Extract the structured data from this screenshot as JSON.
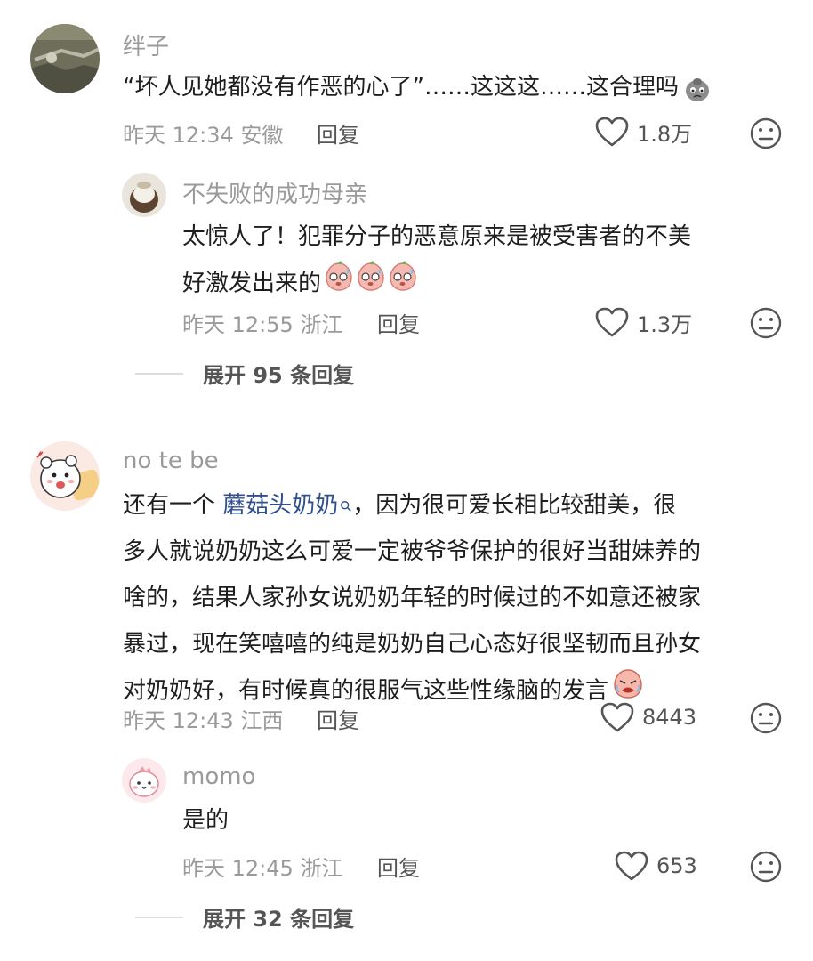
{
  "comments": [
    {
      "username": "绊子",
      "text": "“坏人见她都没有作恶的心了”……这这这……这合理吗",
      "time": "昨天 12:34",
      "location": "安徽",
      "reply_label": "回复",
      "likes": "1.8万",
      "replies": [
        {
          "username": "不失败的成功母亲",
          "text_line1": "太惊人了！犯罪分子的恶意原来是被受害者的不美",
          "text_line2": "好激发出来的",
          "time": "昨天 12:55",
          "location": "浙江",
          "reply_label": "回复",
          "likes": "1.3万"
        }
      ],
      "expand_label": "展开 95 条回复"
    },
    {
      "username": "no te be",
      "text_prefix": "还有一个",
      "mention": "蘑菇头奶奶",
      "text_line1_rest": "，因为很可爱长相比较甜美，很",
      "text_line2": "多人就说奶奶这么可爱一定被爷爷保护的很好当甜妹养的",
      "text_line3": "啥的，结果人家孙女说奶奶年轻的时候过的不如意还被家",
      "text_line4": "暴过，现在笑嘻嘻的纯是奶奶自己心态好很坚韧而且孙女",
      "text_line5": "对奶奶好，有时候真的很服气这些性缘脑的发言",
      "time": "昨天 12:43",
      "location": "江西",
      "reply_label": "回复",
      "likes": "8443",
      "replies": [
        {
          "username": "momo",
          "text": "是的",
          "time": "昨天 12:45",
          "location": "浙江",
          "reply_label": "回复",
          "likes": "653"
        }
      ],
      "expand_label": "展开 32 条回复"
    }
  ],
  "icons": {
    "like": "heart-outline-icon",
    "dislike": "neutral-face-icon",
    "search": "magnifier-icon"
  }
}
